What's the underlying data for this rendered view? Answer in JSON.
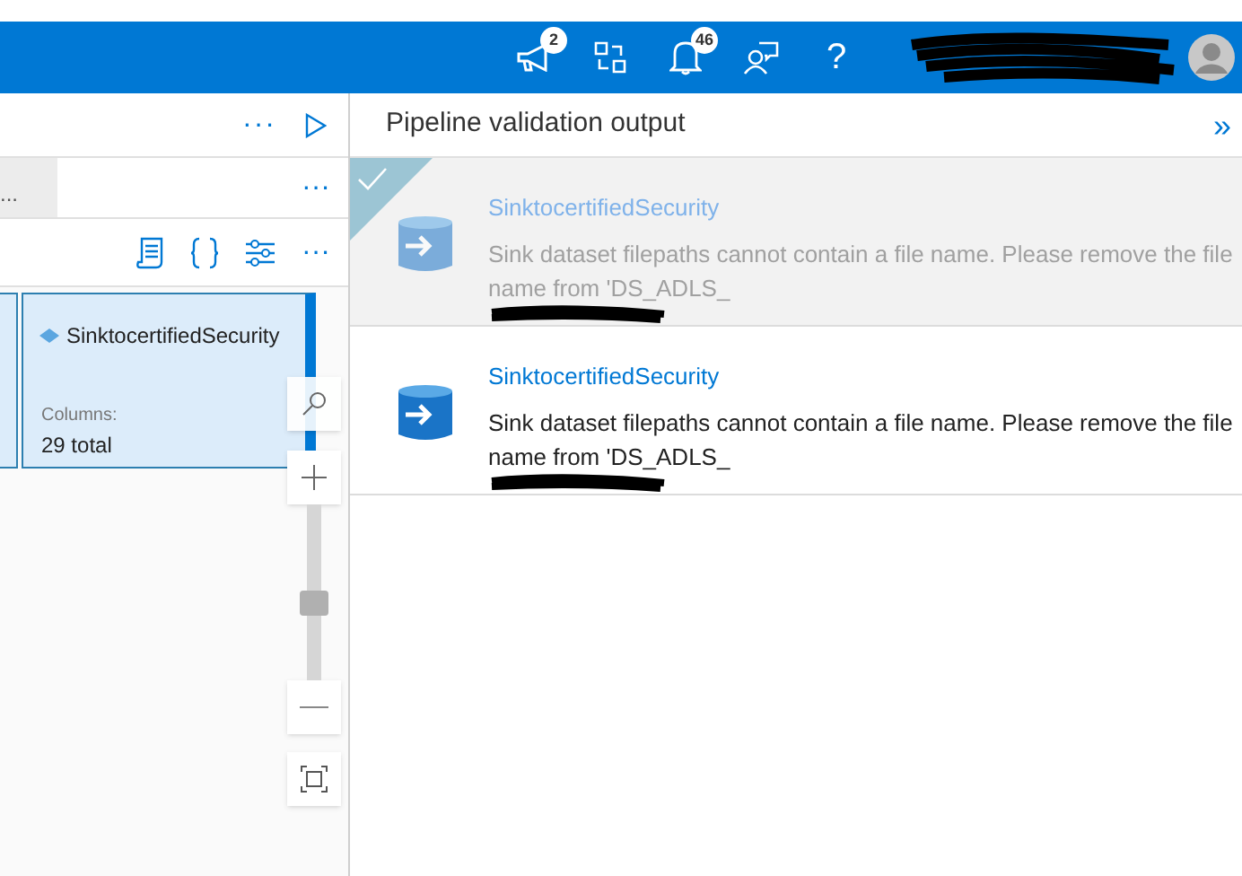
{
  "top_bar": {
    "icons": [
      {
        "kind": "feedback",
        "badge": "2"
      },
      {
        "kind": "directory"
      },
      {
        "kind": "bell",
        "badge": "46"
      },
      {
        "kind": "person"
      },
      {
        "kind": "help",
        "glyph": "?"
      }
    ]
  },
  "left_pane": {
    "toolbar_more": "···",
    "tab_label": "...",
    "tab_more": "···",
    "actions_more": "···",
    "node": {
      "title": "SinktocertifiedSecurity",
      "columns_label": "Columns:",
      "columns_value": "29 total"
    },
    "zoom": {
      "level": 0.43
    }
  },
  "validation_panel": {
    "title": "Pipeline validation output",
    "collapse": "»",
    "items": [
      {
        "title": "SinktocertifiedSecurity",
        "message": "Sink dataset filepaths cannot contain a file name. Please remove the file name from 'DS_ADLS_",
        "selected": true
      },
      {
        "title": "SinktocertifiedSecurity",
        "message": "Sink dataset filepaths cannot contain a file name. Please remove the file name from 'DS_ADLS_",
        "selected": false
      }
    ]
  }
}
